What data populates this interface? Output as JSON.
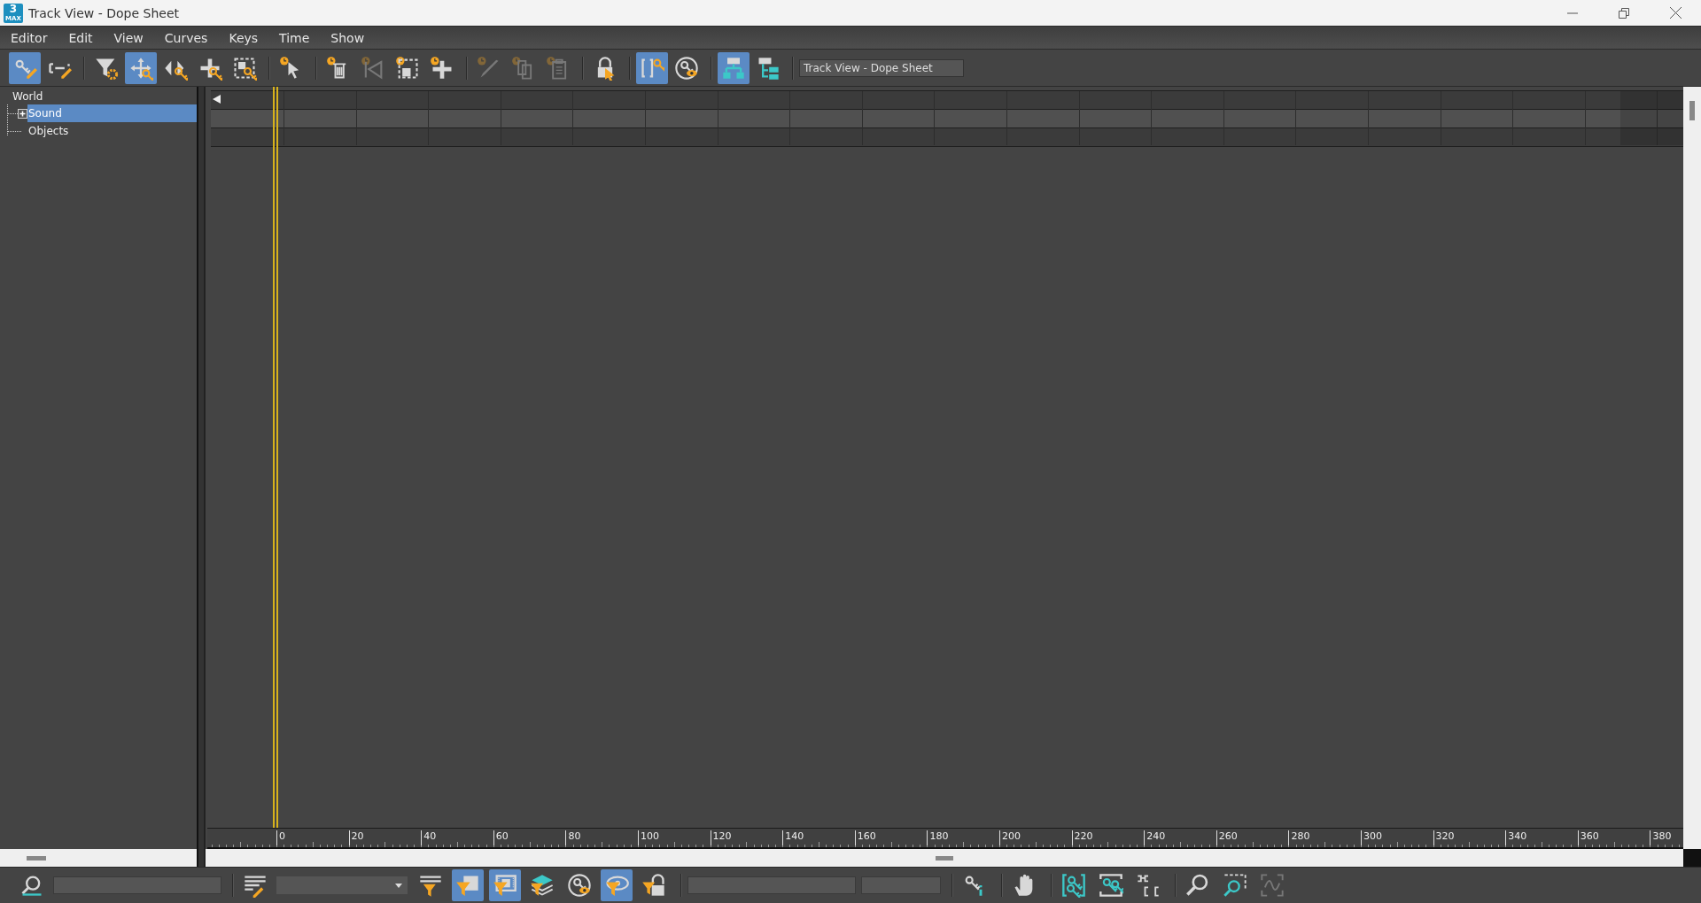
{
  "window": {
    "title": "Track View - Dope Sheet",
    "app_icon": {
      "number": "3",
      "caption": "MAX"
    }
  },
  "menu": [
    "Editor",
    "Edit",
    "View",
    "Curves",
    "Keys",
    "Time",
    "Show"
  ],
  "toolbar": [
    {
      "kind": "key-pencil",
      "selected": true,
      "disabled": false
    },
    {
      "kind": "bracket-pencil",
      "selected": false,
      "disabled": false
    },
    {
      "kind": "sep"
    },
    {
      "kind": "filter-gear",
      "selected": false,
      "disabled": false
    },
    {
      "kind": "move-keys",
      "selected": true,
      "disabled": false
    },
    {
      "kind": "slide-keys",
      "selected": false,
      "disabled": false
    },
    {
      "kind": "add-keys",
      "selected": false,
      "disabled": false
    },
    {
      "kind": "scale-keys",
      "selected": false,
      "disabled": false
    },
    {
      "kind": "sep"
    },
    {
      "kind": "clock-arrow",
      "selected": false,
      "disabled": false
    },
    {
      "kind": "sep"
    },
    {
      "kind": "clock-trash",
      "selected": false,
      "disabled": false
    },
    {
      "kind": "clock-reverse",
      "selected": false,
      "disabled": true
    },
    {
      "kind": "clock-scale",
      "selected": false,
      "disabled": false
    },
    {
      "kind": "clock-plus",
      "selected": false,
      "disabled": false
    },
    {
      "kind": "sep"
    },
    {
      "kind": "clock-knife",
      "selected": false,
      "disabled": true
    },
    {
      "kind": "clock-copy",
      "selected": false,
      "disabled": true
    },
    {
      "kind": "clock-paste",
      "selected": false,
      "disabled": true
    },
    {
      "kind": "sep"
    },
    {
      "kind": "lock-cursor",
      "selected": false,
      "disabled": false
    },
    {
      "kind": "sep"
    },
    {
      "kind": "bracket-key",
      "selected": true,
      "disabled": false
    },
    {
      "kind": "eye-key",
      "selected": false,
      "disabled": false
    },
    {
      "kind": "sep"
    },
    {
      "kind": "hierarchy",
      "selected": true,
      "disabled": false
    },
    {
      "kind": "tree-list",
      "selected": false,
      "disabled": false
    },
    {
      "kind": "sep"
    }
  ],
  "name_field": {
    "value": "Track View - Dope Sheet"
  },
  "tree": {
    "label": "World",
    "children": [
      {
        "label": "Sound",
        "selected": true,
        "expanded": false
      },
      {
        "label": "Objects",
        "selected": false
      }
    ]
  },
  "ruler": [
    "0",
    "20",
    "40",
    "60",
    "80",
    "100",
    "120",
    "140",
    "160",
    "180",
    "200",
    "220",
    "240",
    "260",
    "280",
    "300",
    "320",
    "340",
    "360",
    "380"
  ],
  "bottom_toolbar": [
    {
      "kind": "zoom-track",
      "selected": false
    },
    {
      "kind": "field"
    },
    {
      "kind": "sep"
    },
    {
      "kind": "list-pencil",
      "selected": false
    },
    {
      "kind": "dropdown"
    },
    {
      "kind": "filter-list",
      "selected": false
    },
    {
      "kind": "filter-selected",
      "selected": true
    },
    {
      "kind": "filter-film",
      "selected": true
    },
    {
      "kind": "filter-layers",
      "selected": false
    },
    {
      "kind": "eye-key",
      "selected": false
    },
    {
      "kind": "filter-eye",
      "selected": true
    },
    {
      "kind": "filter-lock",
      "selected": false
    },
    {
      "kind": "sep"
    },
    {
      "kind": "field"
    },
    {
      "kind": "field"
    },
    {
      "kind": "sep"
    },
    {
      "kind": "key-info",
      "selected": false
    },
    {
      "kind": "sep"
    },
    {
      "kind": "hand",
      "selected": false
    },
    {
      "kind": "sep"
    },
    {
      "kind": "frame-keys",
      "selected": false
    },
    {
      "kind": "frame-keys-h",
      "selected": false
    },
    {
      "kind": "frame-range",
      "selected": false
    },
    {
      "kind": "sep"
    },
    {
      "kind": "zoom",
      "selected": false
    },
    {
      "kind": "zoom-region",
      "selected": false
    },
    {
      "kind": "frame-curve",
      "selected": false,
      "disabled": true
    }
  ]
}
